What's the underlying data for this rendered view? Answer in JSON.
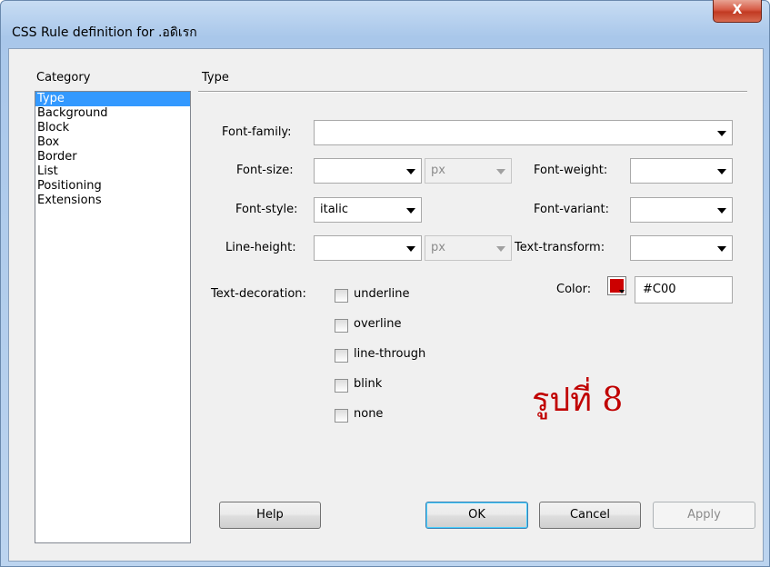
{
  "window": {
    "title": "CSS Rule definition for .อดิเรก",
    "close_label": "X"
  },
  "category": {
    "label": "Category",
    "items": [
      "Type",
      "Background",
      "Block",
      "Box",
      "Border",
      "List",
      "Positioning",
      "Extensions"
    ],
    "selected": "Type"
  },
  "section": {
    "title": "Type"
  },
  "fields": {
    "font_family": {
      "label": "Font-family:",
      "value": ""
    },
    "font_size": {
      "label": "Font-size:",
      "value": "",
      "unit": "px"
    },
    "font_weight": {
      "label": "Font-weight:",
      "value": ""
    },
    "font_style": {
      "label": "Font-style:",
      "value": "italic"
    },
    "font_variant": {
      "label": "Font-variant:",
      "value": ""
    },
    "line_height": {
      "label": "Line-height:",
      "value": "",
      "unit": "px"
    },
    "text_transform": {
      "label": "Text-transform:",
      "value": ""
    },
    "color": {
      "label": "Color:",
      "value": "#C00",
      "swatch": "#cc0000"
    }
  },
  "text_decoration": {
    "label": "Text-decoration:",
    "options": [
      {
        "label": "underline",
        "checked": false
      },
      {
        "label": "overline",
        "checked": false
      },
      {
        "label": "line-through",
        "checked": false
      },
      {
        "label": "blink",
        "checked": false
      },
      {
        "label": "none",
        "checked": false
      }
    ]
  },
  "buttons": {
    "help": "Help",
    "ok": "OK",
    "cancel": "Cancel",
    "apply": "Apply"
  },
  "overlay_text": "รูปที่ 8"
}
